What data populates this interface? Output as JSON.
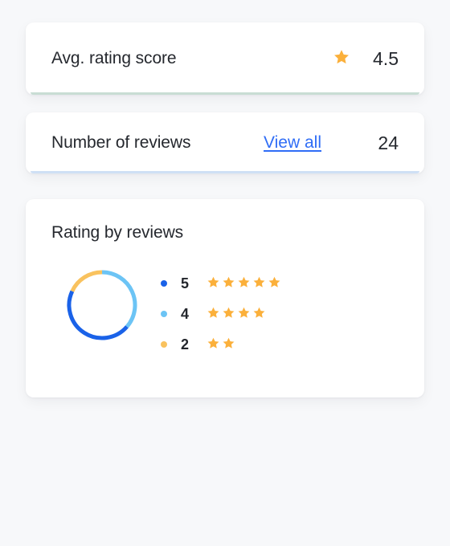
{
  "theme": {
    "page_background": "#f7f8fa",
    "card_background": "#ffffff",
    "text_color": "#25282e",
    "link_color": "#2f6df6",
    "star_color": "#fbb03b",
    "accent_green": "#c8ddd4",
    "accent_blue": "#cfe0f5"
  },
  "avg_rating_card": {
    "label": "Avg. rating score",
    "star_icon": "star-icon",
    "value": "4.5",
    "accent_color": "#c8ddd4"
  },
  "num_reviews_card": {
    "label": "Number of reviews",
    "link_label": "View all",
    "value": "24",
    "accent_color": "#cfe0f5"
  },
  "rating_breakdown_card": {
    "title": "Rating by reviews",
    "legend": [
      {
        "count": "5",
        "stars": 5,
        "dot_color": "#1a62e8"
      },
      {
        "count": "4",
        "stars": 4,
        "dot_color": "#6cc4f5"
      },
      {
        "count": "2",
        "stars": 2,
        "dot_color": "#f9c25e"
      }
    ]
  },
  "chart_data": {
    "type": "pie",
    "title": "Rating by reviews",
    "subtitle": "",
    "donut": true,
    "inner_radius_ratio": 0.9,
    "start_angle_deg": 0,
    "direction": "clockwise",
    "labels": [
      "5 stars",
      "4 stars",
      "2 stars"
    ],
    "categories": [
      "5",
      "4",
      "2"
    ],
    "values": [
      5,
      4,
      2
    ],
    "percentages": [
      45.5,
      36.4,
      18.2
    ],
    "colors": [
      "#1a62e8",
      "#6cc4f5",
      "#f9c25e"
    ],
    "segments": [
      {
        "label": "4",
        "value": 4,
        "percent": 36.4,
        "color": "#6cc4f5",
        "start_deg": 0,
        "end_deg": 131
      },
      {
        "label": "5",
        "value": 5,
        "percent": 45.5,
        "color": "#1a62e8",
        "start_deg": 131,
        "end_deg": 295
      },
      {
        "label": "2",
        "value": 2,
        "percent": 18.2,
        "color": "#f9c25e",
        "start_deg": 295,
        "end_deg": 360
      }
    ],
    "legend_position": "right",
    "grid": false,
    "xlabel": "",
    "ylabel": ""
  }
}
